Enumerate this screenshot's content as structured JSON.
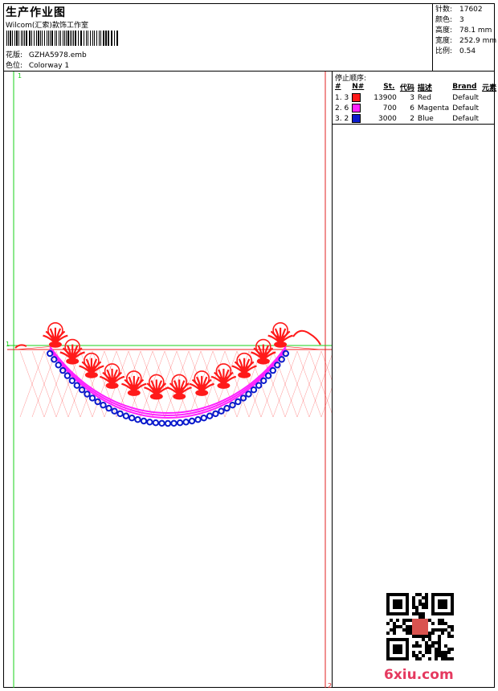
{
  "header": {
    "title": "生产作业图",
    "studio": "Wilcom(汇索)款饰工作室",
    "design_label": "花版:",
    "design_file": "GZHA5978.emb",
    "colorway_label": "色位:",
    "colorway": "Colorway 1"
  },
  "stats": [
    {
      "label": "针数:",
      "value": "17602"
    },
    {
      "label": "颜色:",
      "value": "3"
    },
    {
      "label": "高度:",
      "value": "78.1 mm"
    },
    {
      "label": "宽度:",
      "value": "252.9 mm"
    },
    {
      "label": "比例:",
      "value": "0.54"
    }
  ],
  "stop_sequence": {
    "title": "停止顺序:",
    "headers": [
      "#",
      "N#",
      "St.",
      "代码",
      "描述",
      "Brand",
      "元素"
    ],
    "rows": [
      {
        "index": "1. 3",
        "color": "#ff1a1a",
        "stitches": "13900",
        "code": "3",
        "desc": "Red",
        "brand": "Default"
      },
      {
        "index": "2. 6",
        "color": "#ff22ff",
        "stitches": "700",
        "code": "6",
        "desc": "Magenta",
        "brand": "Default"
      },
      {
        "index": "3. 2",
        "color": "#0a1acc",
        "stitches": "3000",
        "code": "2",
        "desc": "Blue",
        "brand": "Default"
      }
    ]
  },
  "canvas": {
    "marker_start": "1",
    "marker_end": "2",
    "corner_marker": "1"
  },
  "watermark": {
    "brand": "6xiu.com"
  },
  "colors": {
    "guide_green": "#19d019",
    "guide_red": "#e02020",
    "red_thread": "#ff1a1a",
    "magenta_thread": "#ff22ff",
    "blue_thread": "#0a1acc"
  }
}
